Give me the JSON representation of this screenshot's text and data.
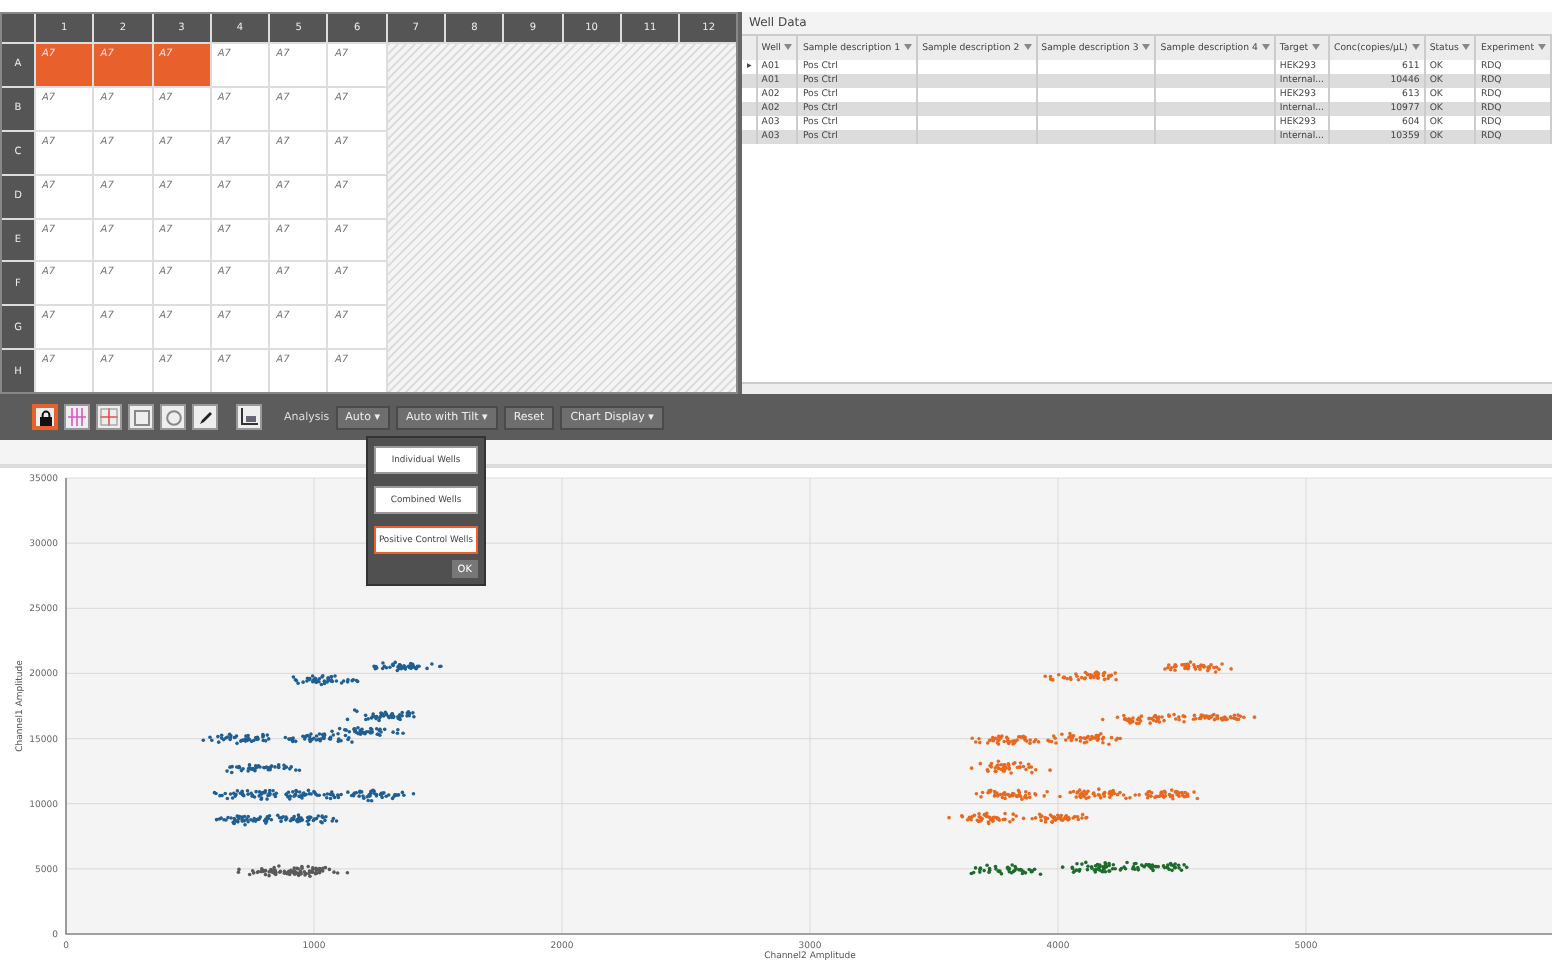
{
  "plate": {
    "columns": [
      "1",
      "2",
      "3",
      "4",
      "5",
      "6",
      "7",
      "8",
      "9",
      "10",
      "11",
      "12"
    ],
    "rows": [
      {
        "label": "A",
        "cells": [
          {
            "text": "A7",
            "selected": true
          },
          {
            "text": "A7",
            "selected": true
          },
          {
            "text": "A7",
            "selected": true
          },
          {
            "text": "A7",
            "selected": false
          },
          {
            "text": "A7",
            "selected": false
          },
          {
            "text": "A7",
            "selected": false
          }
        ]
      },
      {
        "label": "B",
        "cells": [
          {
            "text": "A7",
            "selected": false
          },
          {
            "text": "A7",
            "selected": false
          },
          {
            "text": "A7",
            "selected": false
          },
          {
            "text": "A7",
            "selected": false
          },
          {
            "text": "A7",
            "selected": false
          },
          {
            "text": "A7",
            "selected": false
          }
        ]
      },
      {
        "label": "C",
        "cells": [
          {
            "text": "A7",
            "selected": false
          },
          {
            "text": "A7",
            "selected": false
          },
          {
            "text": "A7",
            "selected": false
          },
          {
            "text": "A7",
            "selected": false
          },
          {
            "text": "A7",
            "selected": false
          },
          {
            "text": "A7",
            "selected": false
          }
        ]
      },
      {
        "label": "D",
        "cells": [
          {
            "text": "A7",
            "selected": false
          },
          {
            "text": "A7",
            "selected": false
          },
          {
            "text": "A7",
            "selected": false
          },
          {
            "text": "A7",
            "selected": false
          },
          {
            "text": "A7",
            "selected": false
          },
          {
            "text": "A7",
            "selected": false
          }
        ]
      },
      {
        "label": "E",
        "cells": [
          {
            "text": "A7",
            "selected": false
          },
          {
            "text": "A7",
            "selected": false
          },
          {
            "text": "A7",
            "selected": false
          },
          {
            "text": "A7",
            "selected": false
          },
          {
            "text": "A7",
            "selected": false
          },
          {
            "text": "A7",
            "selected": false
          }
        ]
      },
      {
        "label": "F",
        "cells": [
          {
            "text": "A7",
            "selected": false
          },
          {
            "text": "A7",
            "selected": false
          },
          {
            "text": "A7",
            "selected": false
          },
          {
            "text": "A7",
            "selected": false
          },
          {
            "text": "A7",
            "selected": false
          },
          {
            "text": "A7",
            "selected": false
          }
        ]
      },
      {
        "label": "G",
        "cells": [
          {
            "text": "A7",
            "selected": false
          },
          {
            "text": "A7",
            "selected": false
          },
          {
            "text": "A7",
            "selected": false
          },
          {
            "text": "A7",
            "selected": false
          },
          {
            "text": "A7",
            "selected": false
          },
          {
            "text": "A7",
            "selected": false
          }
        ]
      },
      {
        "label": "H",
        "cells": [
          {
            "text": "A7",
            "selected": false
          },
          {
            "text": "A7",
            "selected": false
          },
          {
            "text": "A7",
            "selected": false
          },
          {
            "text": "A7",
            "selected": false
          },
          {
            "text": "A7",
            "selected": false
          },
          {
            "text": "A7",
            "selected": false
          }
        ]
      }
    ]
  },
  "well_data": {
    "title": "Well Data",
    "columns": [
      "Well",
      "Sample description 1",
      "Sample description 2",
      "Sample description 3",
      "Sample description 4",
      "Target",
      "Conc(copies/µL)",
      "Status",
      "Experiment"
    ],
    "rows": [
      {
        "marker": "▸",
        "cells": [
          "A01",
          "Pos Ctrl",
          "",
          "",
          "",
          "HEK293",
          "611",
          "OK",
          "RDQ"
        ]
      },
      {
        "cells": [
          "A01",
          "Pos Ctrl",
          "",
          "",
          "",
          "Internal...",
          "10446",
          "OK",
          "RDQ"
        ]
      },
      {
        "cells": [
          "A02",
          "Pos Ctrl",
          "",
          "",
          "",
          "HEK293",
          "613",
          "OK",
          "RDQ"
        ]
      },
      {
        "cells": [
          "A02",
          "Pos Ctrl",
          "",
          "",
          "",
          "Internal...",
          "10977",
          "OK",
          "RDQ"
        ]
      },
      {
        "cells": [
          "A03",
          "Pos Ctrl",
          "",
          "",
          "",
          "HEK293",
          "604",
          "OK",
          "RDQ"
        ]
      },
      {
        "cells": [
          "A03",
          "Pos Ctrl",
          "",
          "",
          "",
          "Internal...",
          "10359",
          "OK",
          "RDQ"
        ]
      }
    ]
  },
  "toolbar": {
    "tools": [
      {
        "kind": "lock",
        "selected": true
      },
      {
        "kind": "crosshair",
        "selected": false
      },
      {
        "kind": "grid",
        "selected": false
      },
      {
        "kind": "rectangle",
        "selected": false
      },
      {
        "kind": "ellipse",
        "selected": false
      },
      {
        "kind": "pen",
        "selected": false
      },
      {
        "kind": "chart",
        "selected": false
      }
    ],
    "analysis_label": "Analysis",
    "buttons": [
      {
        "label": "Auto",
        "caret": "▾"
      },
      {
        "label": "Auto with Tilt",
        "caret": "▾"
      },
      {
        "label": "Reset"
      },
      {
        "label": "Chart Display",
        "caret": "▾"
      }
    ]
  },
  "popup": {
    "options": [
      {
        "label": "Individual Wells",
        "selected": false
      },
      {
        "label": "Combined Wells",
        "selected": false
      },
      {
        "label": "Positive Control Wells",
        "selected": true
      }
    ],
    "ok": "OK"
  },
  "chart": {
    "xlabel": "Channel2 Amplitude",
    "ylabel": "Channel1 Amplitude",
    "x_tick_labels": [
      "0",
      "1000",
      "2000",
      "3000",
      "4000",
      "5000"
    ],
    "y_tick_labels": [
      "35000",
      "30000",
      "25000",
      "20000",
      "15000",
      "10000",
      "5000",
      "0"
    ]
  }
}
